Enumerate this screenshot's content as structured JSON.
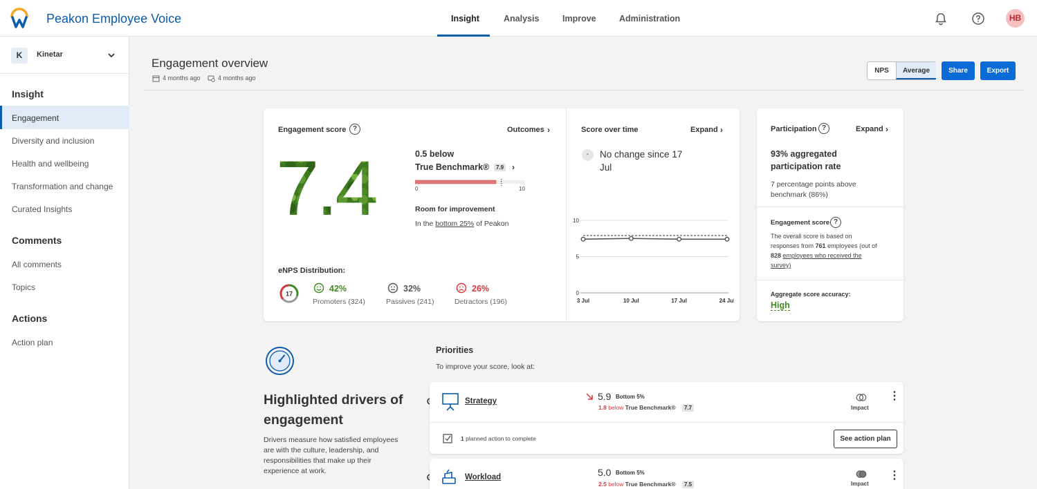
{
  "app": {
    "title": "Peakon Employee Voice",
    "avatar_initials": "HB",
    "brand_color": "#0b5cab"
  },
  "nav": {
    "tabs": [
      "Insight",
      "Analysis",
      "Improve",
      "Administration"
    ],
    "active": "Insight"
  },
  "sidebar": {
    "company_initial": "K",
    "company_name": "Kinetar",
    "sections": [
      {
        "title": "Insight",
        "items": [
          "Engagement",
          "Diversity and inclusion",
          "Health and wellbeing",
          "Transformation and change",
          "Curated Insights"
        ]
      },
      {
        "title": "Comments",
        "items": [
          "All comments",
          "Topics"
        ]
      },
      {
        "title": "Actions",
        "items": [
          "Action plan"
        ]
      }
    ],
    "active_item": "Engagement"
  },
  "header": {
    "title": "Engagement overview",
    "meta_1": "4 months ago",
    "meta_2": "4 months ago",
    "toggle_nps": "NPS",
    "toggle_average": "Average",
    "share": "Share",
    "export": "Export"
  },
  "engagement": {
    "label": "Engagement score",
    "score": "7.4",
    "outcomes": "Outcomes",
    "benchmark_delta": "0.5 below",
    "benchmark_name": "True Benchmark®",
    "benchmark_value": "7.9",
    "scale_min": "0",
    "scale_max": "10",
    "score_fraction": 0.74,
    "benchmark_fraction": 0.79,
    "room_title": "Room for improvement",
    "room_prefix": "In the",
    "room_link": "bottom 25%",
    "room_suffix": "of Peakon",
    "enps_label": "eNPS Distribution:",
    "enps_value": "17",
    "promoters_pct": "42%",
    "promoters_label": "Promoters (324)",
    "passives_pct": "32%",
    "passives_label": "Passives (241)",
    "detractors_pct": "26%",
    "detractors_label": "Detractors (196)"
  },
  "score_over_time": {
    "label": "Score over time",
    "expand": "Expand",
    "change_icon": "-",
    "change_text_1": "No change since 17",
    "change_text_2": "Jul",
    "y_ticks": [
      "10",
      "5",
      "0"
    ],
    "x_ticks": [
      "3 Jul",
      "10 Jul",
      "17 Jul",
      "24 Jul"
    ]
  },
  "chart_data": {
    "type": "line",
    "x": [
      "3 Jul",
      "10 Jul",
      "17 Jul",
      "24 Jul"
    ],
    "series": [
      {
        "values": [
          7.4,
          7.5,
          7.4,
          7.4
        ]
      },
      {
        "values": [
          7.9,
          7.9,
          7.9,
          7.9
        ]
      }
    ],
    "ylim": [
      0,
      10
    ]
  },
  "participation": {
    "label": "Participation",
    "expand": "Expand",
    "headline_1": "93% aggregated",
    "headline_2": "participation rate",
    "sub_1": "7 percentage points above",
    "sub_2": "benchmark (86%)",
    "eng_label": "Engagement score",
    "eng_text_1": "The overall score is based on",
    "eng_text_2a": "responses from",
    "eng_text_2b": "761",
    "eng_text_2c": "employees (out of",
    "eng_text_3a": "828",
    "eng_text_3b": "employees who received the",
    "eng_text_4": "survey)",
    "accuracy_label": "Aggregate score accuracy:",
    "accuracy_value": "High"
  },
  "drivers": {
    "title_1": "Highlighted drivers of",
    "title_2": "engagement",
    "desc_1": "Drivers measure how satisfied employees",
    "desc_2": "are with the culture, leadership, and",
    "desc_3": "responsibilities that make up their",
    "desc_4": "experience at work."
  },
  "priorities": {
    "title": "Priorities",
    "subtitle": "To improve your score, look at:",
    "items": [
      {
        "name": "Strategy",
        "score": "5.9",
        "rank": "Bottom 5%",
        "delta": "1.8",
        "below": "below",
        "benchmark": "True Benchmark®",
        "benchmark_value": "7.7",
        "impact": "Impact",
        "actions_count": "1",
        "actions_text": "planned action to complete",
        "action_button": "See action plan"
      },
      {
        "name": "Workload",
        "score": "5.0",
        "rank": "Bottom 5%",
        "delta": "2.5",
        "below": "below",
        "benchmark": "True Benchmark®",
        "benchmark_value": "7.5",
        "impact": "Impact"
      }
    ]
  }
}
